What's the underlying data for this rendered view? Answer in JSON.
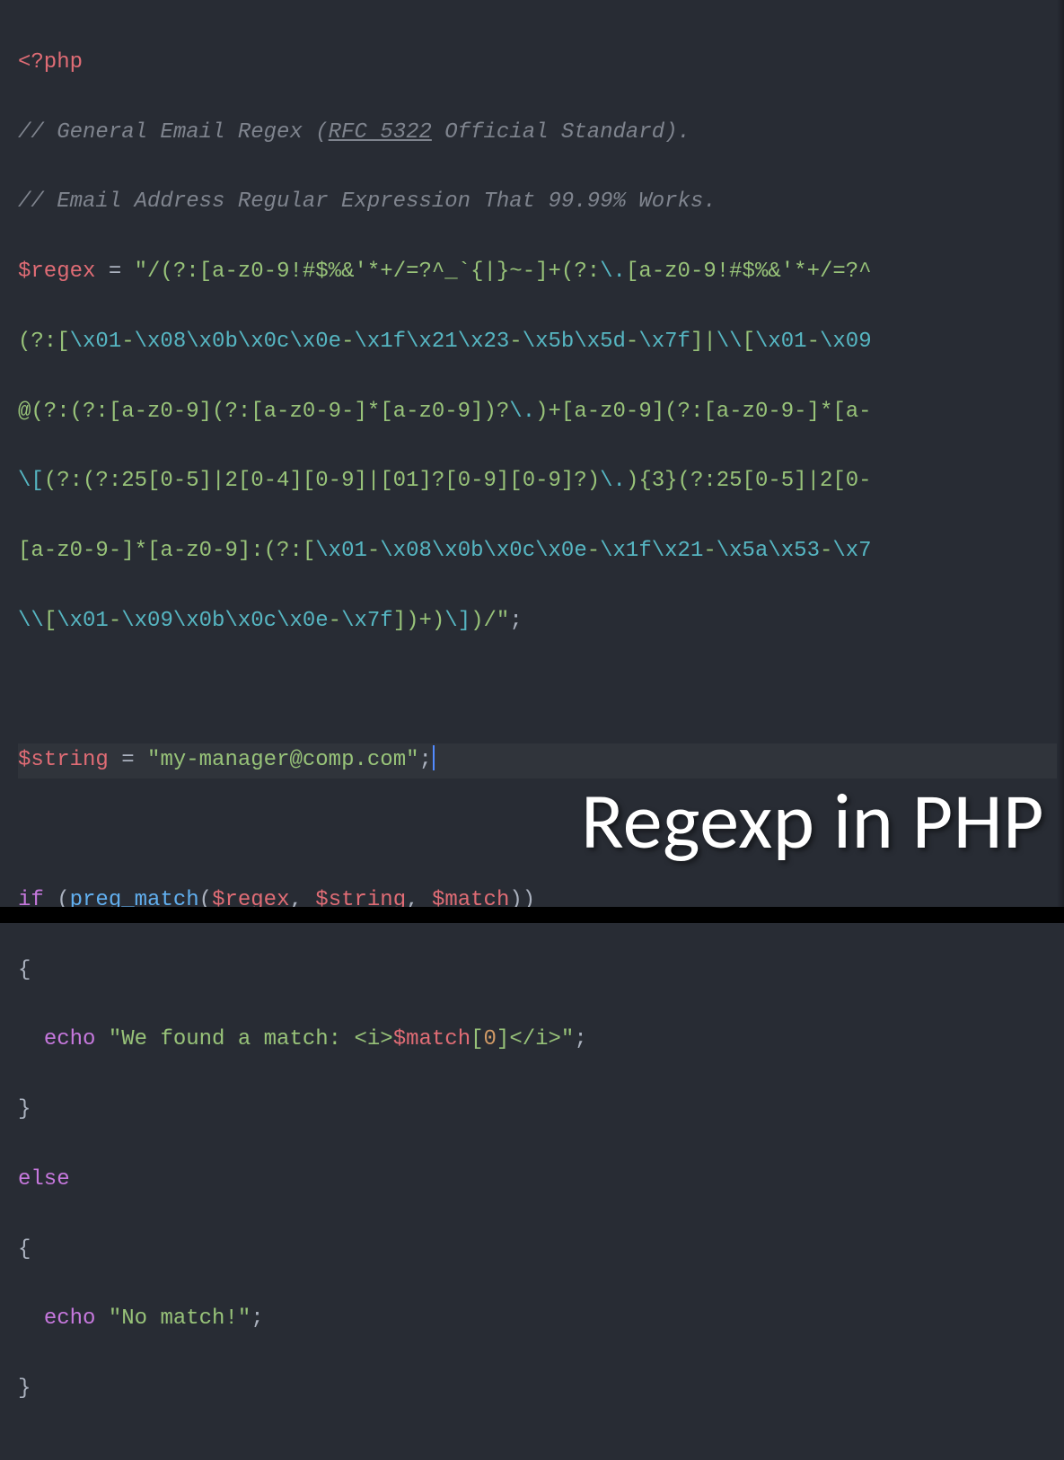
{
  "code": {
    "l1": {
      "tag": "<?php"
    },
    "l2": {
      "comment_pre": "// General Email Regex (",
      "rfc": "RFC 5322",
      "comment_post": " Official Standard)."
    },
    "l3": {
      "comment": "// Email Address Regular Expression That 99.99% Works."
    },
    "l4": {
      "var": "$regex",
      "op": " = ",
      "str1": "\"/(?:[a-z0-9!#$%&'*+/=?^_`{|}~-]+(?:",
      "esc1": "\\.",
      "str2": "[a-z0-9!#$%&'*+/=?^"
    },
    "l5": {
      "str1": "(?:[",
      "e1": "\\x01",
      "s2": "-",
      "e2": "\\x08\\x0b\\x0c\\x0e",
      "s3": "-",
      "e3": "\\x1f\\x21\\x23",
      "s4": "-",
      "e4": "\\x5b\\x5d",
      "s5": "-",
      "e5": "\\x7f",
      "s6": "]|",
      "e6": "\\\\",
      "s7": "[",
      "e7": "\\x01",
      "s8": "-",
      "e8": "\\x09"
    },
    "l6": {
      "str1": "@(?:(?:[a-z0-9](?:[a-z0-9-]*[a-z0-9])?",
      "e1": "\\.",
      "str2": ")+[a-z0-9](?:[a-z0-9-]*[a-"
    },
    "l7": {
      "e0": "\\[",
      "str1": "(?:(?:25[0-5]|2[0-4][0-9]|[01]?[0-9][0-9]?)",
      "e1": "\\.",
      "str2": "){3}(?:25[0-5]|2[0-"
    },
    "l8": {
      "str1": "[a-z0-9-]*[a-z0-9]:(?:[",
      "e1": "\\x01",
      "s2": "-",
      "e2": "\\x08\\x0b\\x0c\\x0e",
      "s3": "-",
      "e3": "\\x1f\\x21",
      "s4": "-",
      "e4": "\\x5a\\x53",
      "s5": "-",
      "e5": "\\x7"
    },
    "l9": {
      "e1": "\\\\",
      "s1": "[",
      "e2": "\\x01",
      "s2": "-",
      "e3": "\\x09\\x0b\\x0c\\x0e",
      "s3": "-",
      "e4": "\\x7f",
      "s4": "])+)",
      "e5": "\\]",
      "s5": ")/\"",
      "semi": ";"
    },
    "l11": {
      "var": "$string",
      "op": " = ",
      "str": "\"my-manager@comp.com\"",
      "semi": ";"
    },
    "l13": {
      "kw": "if",
      "p1": " (",
      "func": "preg_match",
      "p2": "(",
      "var1": "$regex",
      "c1": ", ",
      "var2": "$string",
      "c2": ", ",
      "var3": "$match",
      "p3": "))"
    },
    "l14": {
      "brace": "{"
    },
    "l15": {
      "indent": "  ",
      "kw": "echo",
      "sp": " ",
      "s1": "\"We found a match: <i>",
      "var": "$match",
      "s2": "[",
      "num": "0",
      "s3": "]</i>\"",
      "semi": ";"
    },
    "l16": {
      "brace": "}"
    },
    "l17": {
      "kw": "else"
    },
    "l18": {
      "brace": "{"
    },
    "l19": {
      "indent": "  ",
      "kw": "echo",
      "sp": " ",
      "str": "\"No match!\"",
      "semi": ";"
    },
    "l20": {
      "brace": "}"
    }
  },
  "overlay": {
    "title": "Regexp in PHP"
  }
}
